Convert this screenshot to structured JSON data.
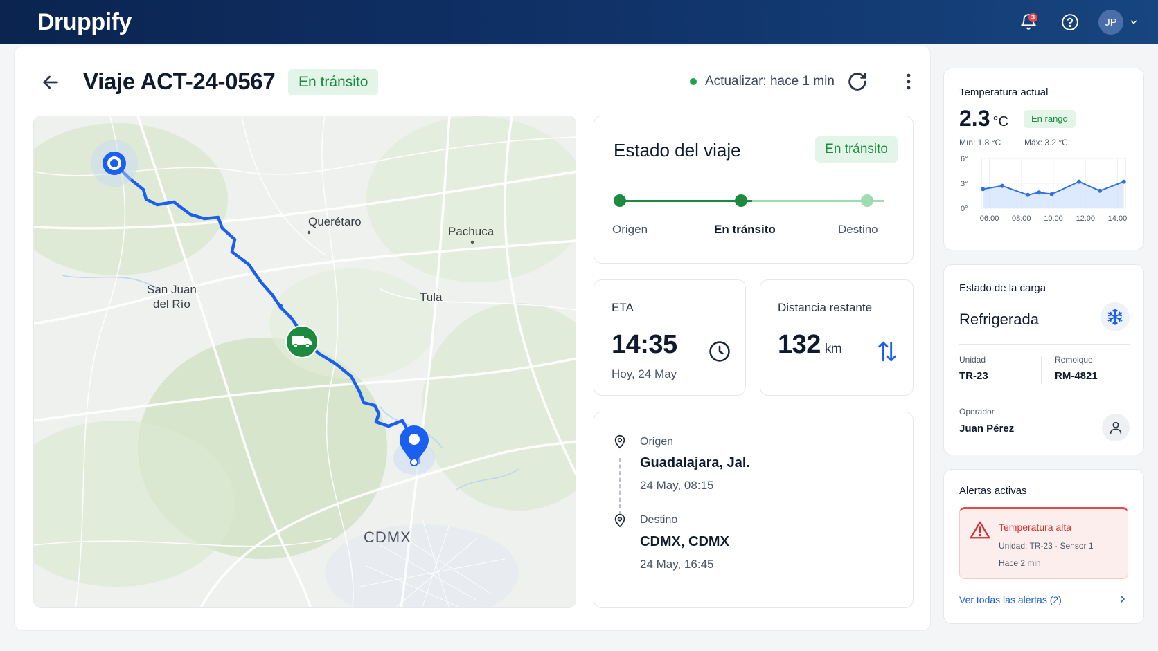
{
  "app": {
    "brand": "Druppify",
    "notifications_count": "3",
    "user_initials": "JP"
  },
  "header": {
    "title": "Viaje ACT-24-0567",
    "status": "En tránsito",
    "update_text": "Actualizar: hace 1 min"
  },
  "map": {
    "cities": [
      "Querétaro",
      "Pachuca",
      "San Juan",
      "del Río",
      "Tula",
      "CDMX"
    ]
  },
  "trip_status": {
    "title": "Estado del viaje",
    "badge": "En tránsito",
    "steps": [
      "Origen",
      "En tránsito",
      "Destino"
    ],
    "current_step": 1
  },
  "eta": {
    "label": "ETA",
    "value": "14:35",
    "sub": "Hoy, 24 May"
  },
  "distance": {
    "label": "Distancia restante",
    "value": "132",
    "unit": "km"
  },
  "route": {
    "origin_label": "Origen",
    "origin_place": "Guadalajara, Jal.",
    "origin_time": "24 May, 08:15",
    "dest_label": "Destino",
    "dest_place": "CDMX, CDMX",
    "dest_time": "24 May, 16:45"
  },
  "temperature": {
    "title": "Temperatura actual",
    "value": "2.3",
    "unit": "°C",
    "badge": "En rango",
    "min": "Mín: 1.8 °C",
    "max": "Máx: 3.2 °C"
  },
  "chart_data": {
    "type": "area",
    "x": [
      "06:00",
      "08:00",
      "10:00",
      "12:00",
      "14:00"
    ],
    "y_ticks": [
      "6°",
      "3°",
      "0°"
    ],
    "ylim": [
      0,
      6
    ],
    "xlim": [
      5.5,
      14.5
    ],
    "points": [
      {
        "x": 5.6,
        "y": 2.3
      },
      {
        "x": 6.8,
        "y": 2.7
      },
      {
        "x": 8.4,
        "y": 1.6
      },
      {
        "x": 9.1,
        "y": 1.9
      },
      {
        "x": 9.9,
        "y": 1.7
      },
      {
        "x": 11.6,
        "y": 3.2
      },
      {
        "x": 12.9,
        "y": 2.1
      },
      {
        "x": 14.4,
        "y": 3.2
      }
    ],
    "color": "#2f6fde"
  },
  "cargo": {
    "title": "Estado de la carga",
    "type": "Refrigerada",
    "unit_label": "Unidad",
    "unit_value": "TR-23",
    "trailer_label": "Remolque",
    "trailer_value": "RM-4821",
    "operator_label": "Operador",
    "operator_value": "Juan Pérez"
  },
  "alerts": {
    "title": "Alertas activas",
    "alert_title": "Temperatura alta",
    "alert_unit": "Unidad: TR-23 · Sensor 1",
    "alert_time": "Hace 2 min",
    "link": "Ver todas las alertas (2)"
  },
  "colors": {
    "brand_dark": "#0b2450",
    "success": "#1c8a3f",
    "route_blue": "#1a5ff0",
    "alert_red": "#d32f2f"
  }
}
